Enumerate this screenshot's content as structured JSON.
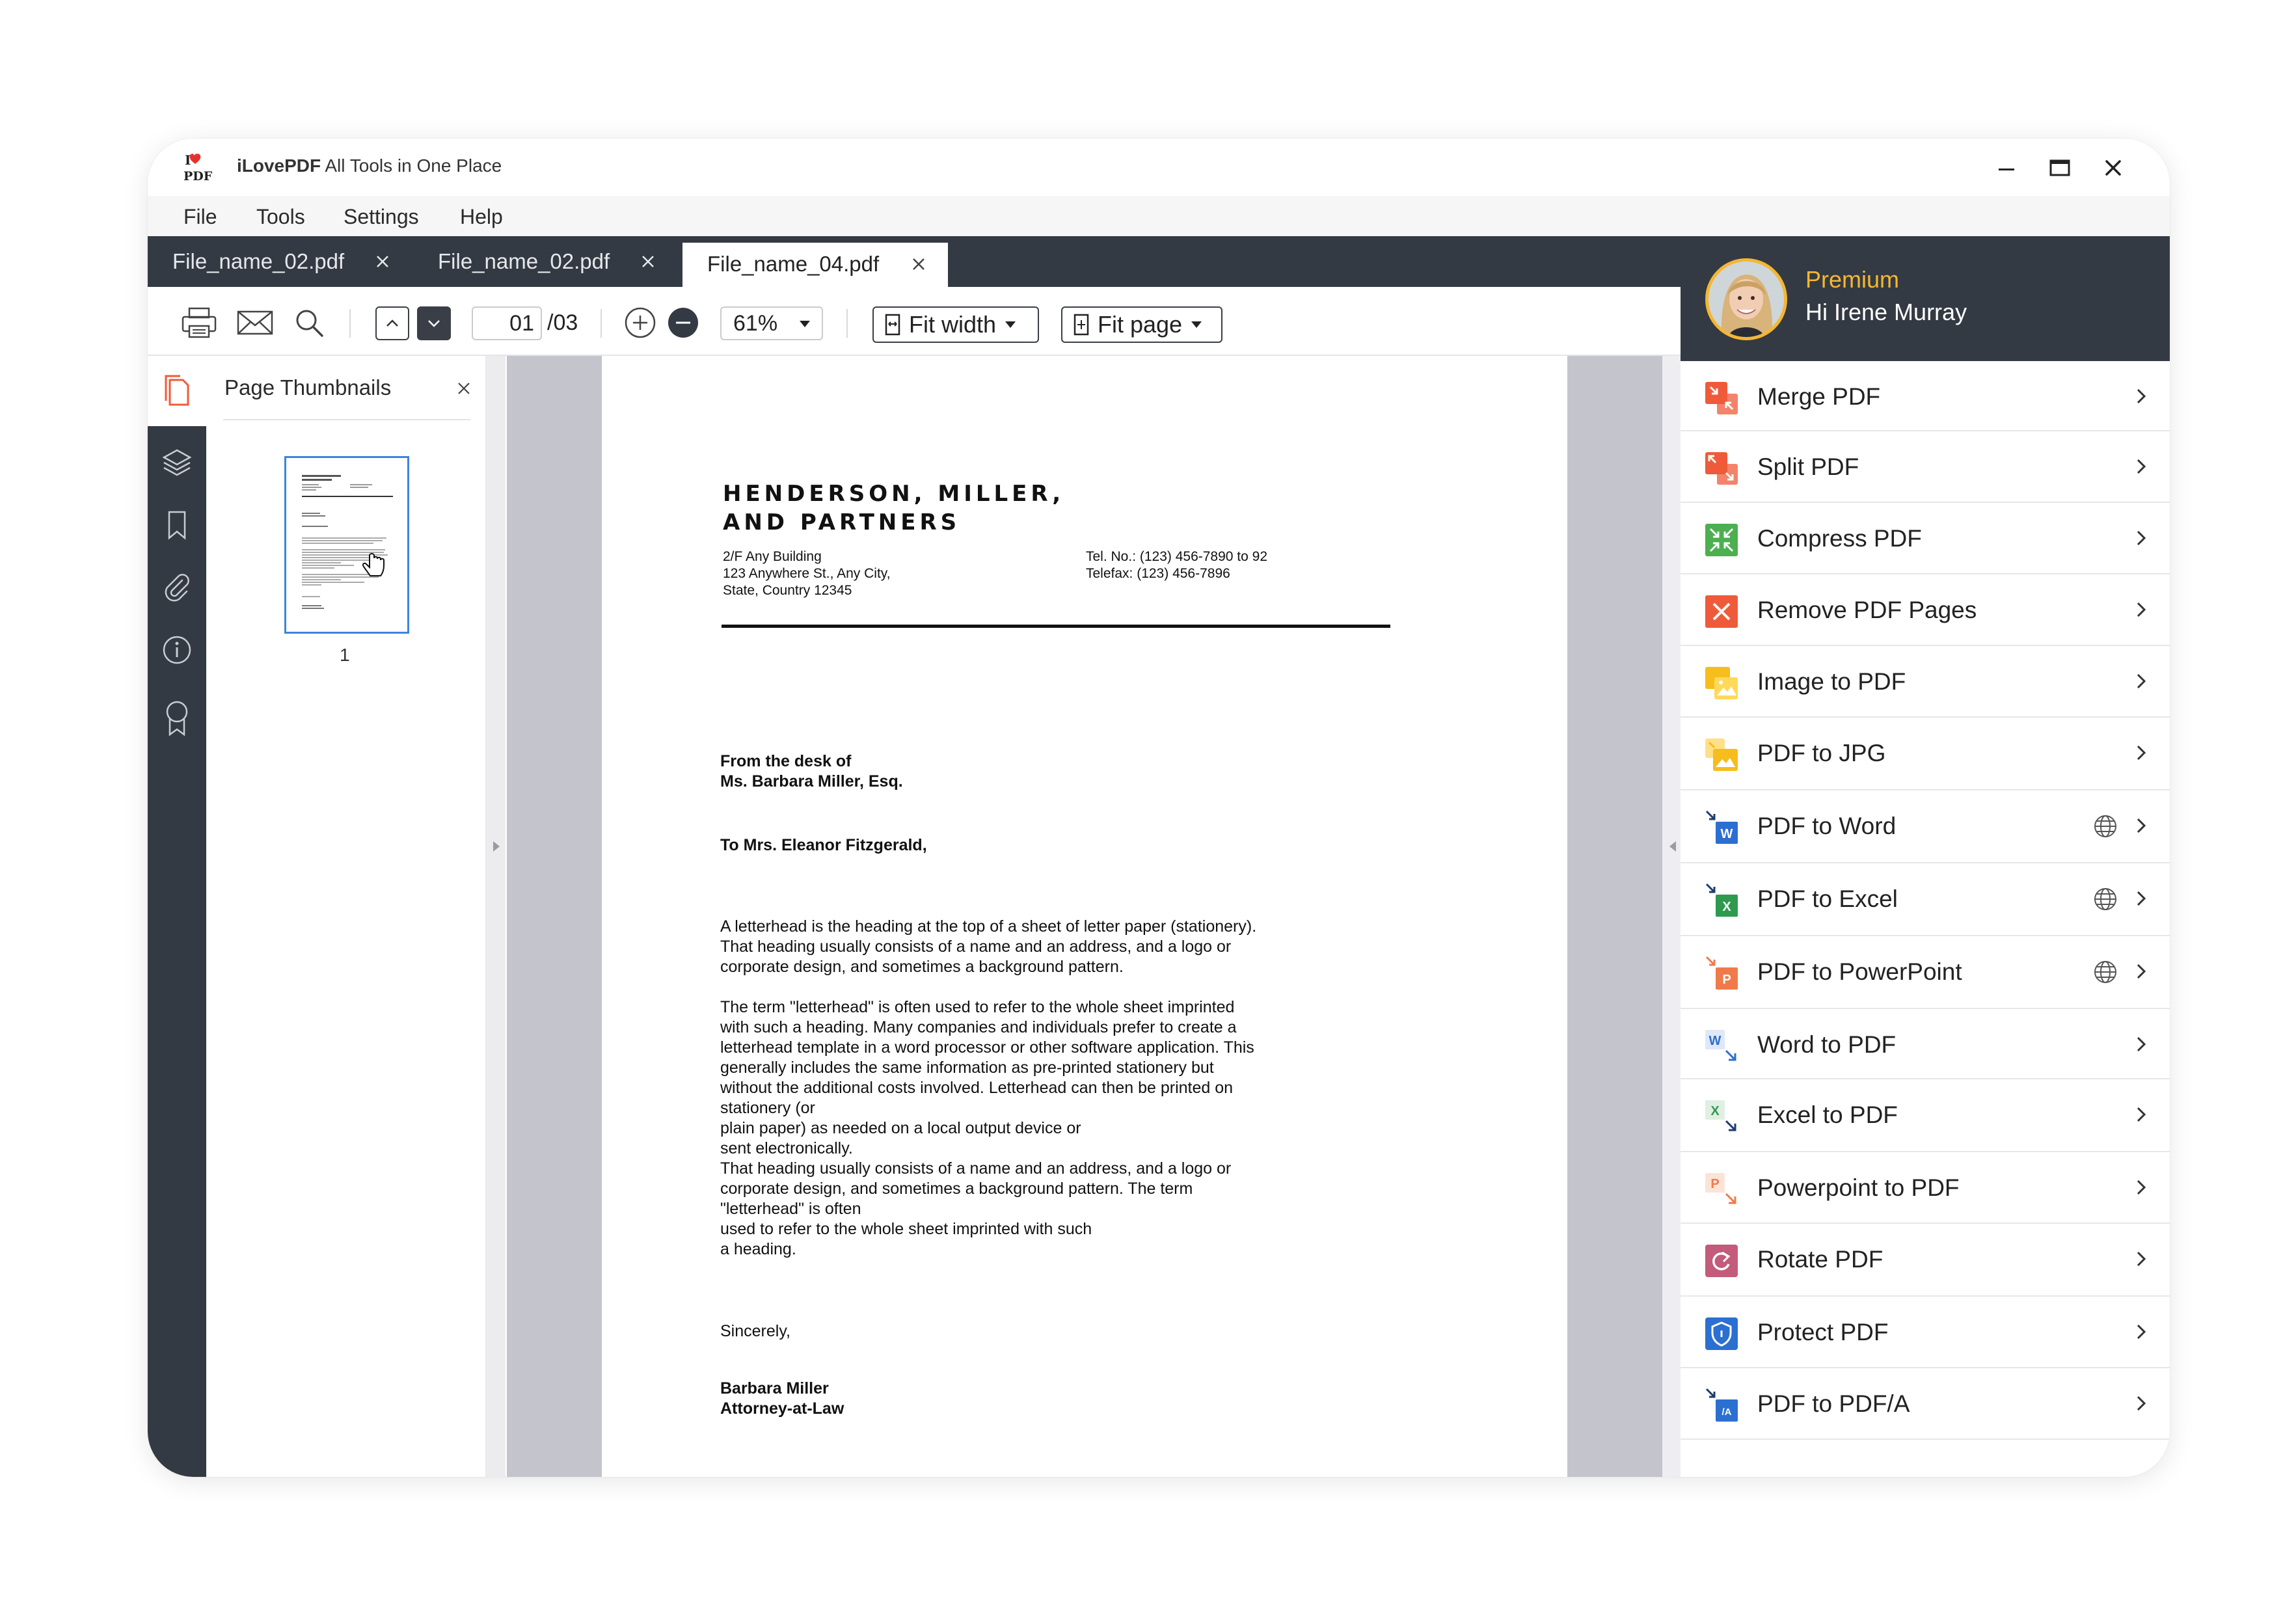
{
  "window": {
    "app_name": "iLovePDF",
    "app_subtitle": "All Tools in One Place",
    "logo_text": "PDF",
    "logo_i": "I"
  },
  "menu": [
    "File",
    "Tools",
    "Settings",
    "Help"
  ],
  "tabs": [
    {
      "label": "File_name_02.pdf",
      "active": false
    },
    {
      "label": "File_name_02.pdf",
      "active": false
    },
    {
      "label": "File_name_04.pdf",
      "active": true
    }
  ],
  "toolbar": {
    "current_page": "01",
    "total_pages": "/03",
    "zoom": "61%",
    "fit_width": "Fit width",
    "fit_page": "Fit page"
  },
  "thumbnails": {
    "title": "Page Thumbnails",
    "pages": [
      "1"
    ]
  },
  "document": {
    "company_line1": "HENDERSON, MILLER,",
    "company_line2": "AND PARTNERS",
    "address": "2/F Any Building\n123 Anywhere St., Any City,\nState, Country 12345",
    "contact": "Tel. No.: (123) 456-7890 to 92\nTelefax: (123) 456-7896",
    "from": "From the desk of\nMs. Barbara Miller, Esq.",
    "to": "To Mrs. Eleanor Fitzgerald,",
    "para1": "A letterhead is the heading at the top of a sheet of letter paper (stationery).\nThat heading usually consists of a name and an address, and a logo or\ncorporate design, and sometimes a background pattern.",
    "para2": "The term \"letterhead\" is often used to refer to the whole sheet imprinted\nwith such a heading. Many companies and individuals prefer to create a\nletterhead template in a word processor or other software application. This\ngenerally includes the same information as pre-printed stationery but\nwithout the additional costs involved. Letterhead can then be printed on\nstationery (or\nplain paper) as needed on a local output device or\nsent electronically.",
    "para3": "That heading usually consists of a name and an address, and a logo or\ncorporate design, and sometimes a background pattern. The term\n\"letterhead\" is often\nused to refer to the whole sheet imprinted with such\na heading.",
    "closing": "Sincerely,",
    "signature": "Barbara Miller\nAttorney-at-Law"
  },
  "user": {
    "plan": "Premium",
    "greeting": "Hi Irene Murray"
  },
  "tools": [
    {
      "label": "Merge PDF",
      "icon": "merge-icon",
      "color": "#ef5b3a",
      "globe": false
    },
    {
      "label": "Split PDF",
      "icon": "split-icon",
      "color": "#ef5b3a",
      "globe": false
    },
    {
      "label": "Compress PDF",
      "icon": "compress-icon",
      "color": "#4caf50",
      "globe": false
    },
    {
      "label": "Remove PDF Pages",
      "icon": "remove-pages-icon",
      "color": "#ef5b3a",
      "globe": false
    },
    {
      "label": "Image to PDF",
      "icon": "image-icon",
      "color": "#f6bd1c",
      "globe": false
    },
    {
      "label": "PDF to JPG",
      "icon": "jpg-icon",
      "color": "#f6bd1c",
      "globe": false
    },
    {
      "label": "PDF to Word",
      "icon": "word-icon",
      "color": "#2b6fd1",
      "globe": true
    },
    {
      "label": "PDF to Excel",
      "icon": "excel-icon",
      "color": "#2e9a4e",
      "globe": true
    },
    {
      "label": "PDF to PowerPoint",
      "icon": "powerpoint-icon",
      "color": "#f07a4a",
      "globe": true
    },
    {
      "label": "Word to PDF",
      "icon": "word-to-pdf-icon",
      "color": "#2b6fd1",
      "globe": false
    },
    {
      "label": "Excel to PDF",
      "icon": "excel-to-pdf-icon",
      "color": "#2e9a4e",
      "globe": false
    },
    {
      "label": "Powerpoint to PDF",
      "icon": "powerpoint-to-pdf-icon",
      "color": "#f07a4a",
      "globe": false
    },
    {
      "label": "Rotate PDF",
      "icon": "rotate-icon",
      "color": "#c35b7a",
      "globe": false
    },
    {
      "label": "Protect PDF",
      "icon": "protect-icon",
      "color": "#2b6fd1",
      "globe": false
    },
    {
      "label": "PDF to PDF/A",
      "icon": "pdfa-icon",
      "color": "#2b6fd1",
      "globe": false
    }
  ],
  "colors": {
    "dark": "#343a43",
    "accent": "#f4b732",
    "thumb_border": "#3f85d8"
  }
}
